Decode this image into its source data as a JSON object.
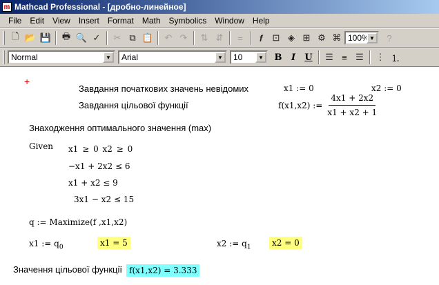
{
  "window": {
    "title": "Mathcad Professional - [дробно-линейное]"
  },
  "menu": [
    "File",
    "Edit",
    "View",
    "Insert",
    "Format",
    "Math",
    "Symbolics",
    "Window",
    "Help"
  ],
  "toolbar": {
    "zoom": "100%"
  },
  "format_bar": {
    "style": "Normal",
    "font": "Arial",
    "size": "10"
  },
  "worksheet": {
    "text1": "Завдання початкових значень невідомих",
    "text2": "Завдання цільової функції",
    "text3": "Знаходження оптимального значення (max)",
    "x1_init": "x1 := 0",
    "x2_init": "x2 := 0",
    "f_lhs": "f(x1,x2) :=",
    "f_num": "4x1 + 2x2",
    "f_den": "x1 + x2 + 1",
    "given": "Given",
    "c1": "x1 ≥ 0    x2 ≥ 0",
    "c2": "−x1 + 2x2 ≤ 6",
    "c3": "x1 + x2 ≤ 9",
    "c4": "3x1 − x2 ≤ 15",
    "maximize": "q := Maximize(f ,x1,x2)",
    "x1_assign": "x1 := q",
    "x1_sub": "0",
    "x1_result": "x1 = 5",
    "x2_assign": "x2 := q",
    "x2_sub": "1",
    "x2_result": "x2 = 0",
    "text4": "Значення цільової функції",
    "f_result": "f(x1,x2) = 3.333"
  }
}
